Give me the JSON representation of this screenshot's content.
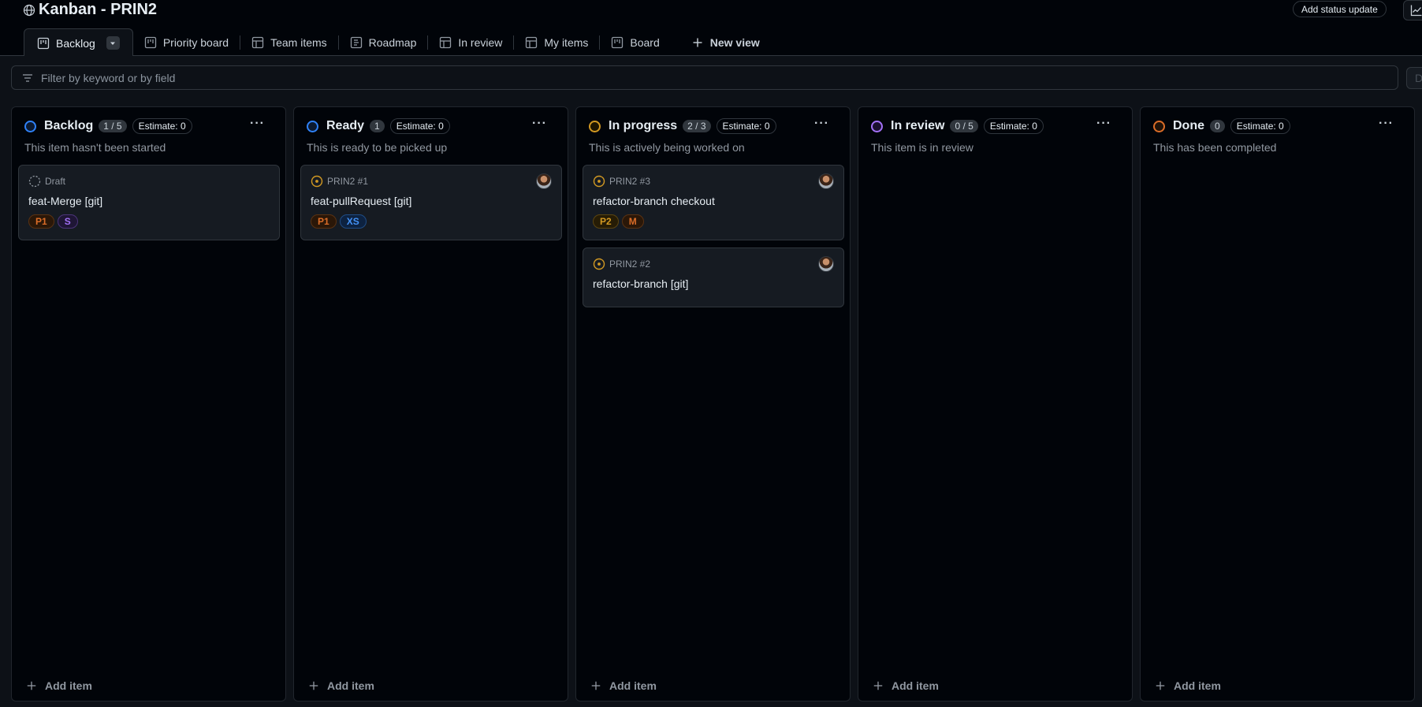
{
  "header": {
    "title": "Kanban - PRIN2",
    "status_button": "Add status update",
    "insights_icon": "graph-icon"
  },
  "tabs": [
    {
      "label": "Backlog",
      "icon": "project-board-icon",
      "active": true
    },
    {
      "label": "Priority board",
      "icon": "project-board-icon"
    },
    {
      "label": "Team items",
      "icon": "table-icon"
    },
    {
      "label": "Roadmap",
      "icon": "roadmap-icon"
    },
    {
      "label": "In review",
      "icon": "table-icon"
    },
    {
      "label": "My items",
      "icon": "table-icon"
    },
    {
      "label": "Board",
      "icon": "project-board-icon"
    }
  ],
  "new_view": "New view",
  "filter": {
    "placeholder": "Filter by keyword or by field",
    "right_button": "Di"
  },
  "colors": {
    "blue": "#2f81f7",
    "orange": "#d29922",
    "purple": "#a371f7",
    "done_orange": "#db6d28"
  },
  "columns": [
    {
      "name": "Backlog",
      "count": "1 / 5",
      "estimate": "Estimate: 0",
      "description": "This item hasn't been started",
      "add_label": "Add item",
      "cards": [
        {
          "meta": "Draft",
          "title": "feat-Merge [git]",
          "labels": [
            "P1",
            "S"
          ]
        }
      ]
    },
    {
      "name": "Ready",
      "count": "1",
      "estimate": "Estimate: 0",
      "description": "This is ready to be picked up",
      "add_label": "Add item",
      "cards": [
        {
          "meta": "PRIN2 #1",
          "title": "feat-pullRequest [git]",
          "labels": [
            "P1",
            "XS"
          ]
        }
      ]
    },
    {
      "name": "In progress",
      "count": "2 / 3",
      "estimate": "Estimate: 0",
      "description": "This is actively being worked on",
      "add_label": "Add item",
      "cards": [
        {
          "meta": "PRIN2 #3",
          "title": "refactor-branch checkout",
          "labels": [
            "P2",
            "M"
          ]
        },
        {
          "meta": "PRIN2 #2",
          "title": "refactor-branch [git]",
          "labels": []
        }
      ]
    },
    {
      "name": "In review",
      "count": "0 / 5",
      "estimate": "Estimate: 0",
      "description": "This item is in review",
      "add_label": "Add item",
      "cards": []
    },
    {
      "name": "Done",
      "count": "0",
      "estimate": "Estimate: 0",
      "description": "This has been completed",
      "add_label": "Add item",
      "cards": []
    }
  ]
}
